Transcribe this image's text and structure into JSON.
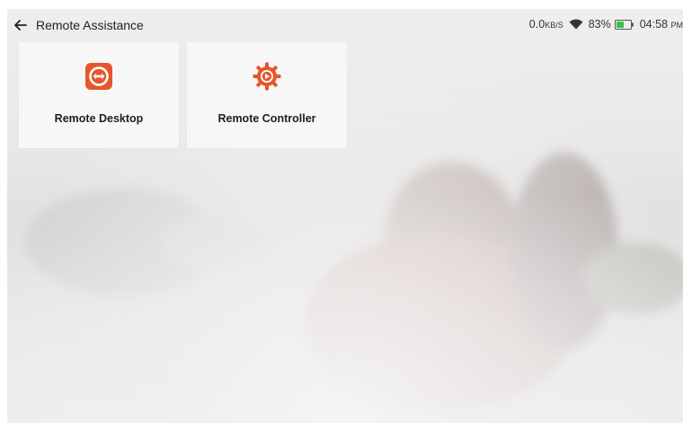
{
  "header": {
    "title": "Remote Assistance",
    "back_icon": "arrow-left-icon"
  },
  "status_bar": {
    "speed_value": "0.0",
    "speed_unit": "KB/S",
    "battery_percent": "83%",
    "time": "04:58",
    "time_suffix": "PM"
  },
  "tiles": [
    {
      "label": "Remote Desktop",
      "icon": "teamviewer-icon",
      "color": "#e4572e"
    },
    {
      "label": "Remote Controller",
      "icon": "remote-controller-gear-icon",
      "color": "#e4572e"
    }
  ],
  "colors": {
    "accent": "#e4572e",
    "battery": "#3cc04a"
  }
}
